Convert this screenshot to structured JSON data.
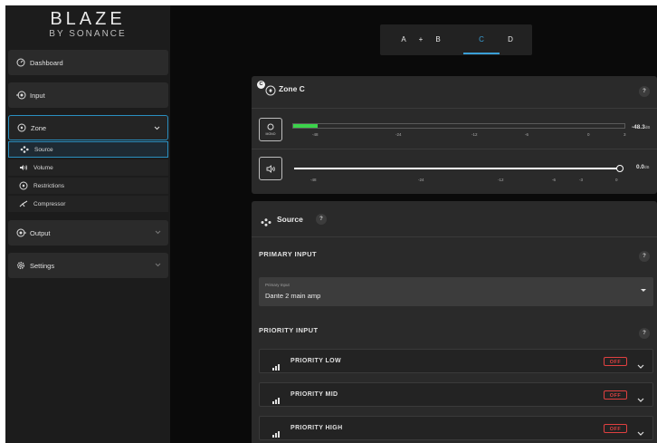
{
  "brand": {
    "name": "BLAZE",
    "sub": "BY SONANCE"
  },
  "sidebar": {
    "items": [
      {
        "label": "Dashboard"
      },
      {
        "label": "Input"
      },
      {
        "label": "Zone"
      },
      {
        "label": "Output"
      },
      {
        "label": "Settings"
      }
    ],
    "zone_sub": [
      {
        "label": "Source"
      },
      {
        "label": "Volume"
      },
      {
        "label": "Restrictions"
      },
      {
        "label": "Compressor"
      }
    ]
  },
  "tabs": [
    "A",
    "+",
    "B",
    "C",
    "D"
  ],
  "active_tab": "C",
  "zone": {
    "badge": "C",
    "title": "Zone C",
    "mono_label": "MONO",
    "meter_ticks": [
      "-48",
      "-24",
      "-12",
      "-6",
      "0",
      "3"
    ],
    "meter_value": "-48.3",
    "meter_unit": "dB",
    "volume_ticks": [
      "-48",
      "-24",
      "-12",
      "-6",
      "-3",
      "0"
    ],
    "volume_value": "0.0",
    "volume_unit": "dB",
    "meter_level": 0.075,
    "volume_level": 1.0
  },
  "source": {
    "title": "Source",
    "primary_heading": "PRIMARY INPUT",
    "primary_field_label": "Primary Input",
    "primary_field_value": "Dante 2 main amp",
    "priority_heading": "PRIORITY INPUT",
    "priorities": [
      {
        "label": "PRIORITY LOW",
        "status": "OFF"
      },
      {
        "label": "PRIORITY MID",
        "status": "OFF"
      },
      {
        "label": "PRIORITY HIGH",
        "status": "OFF"
      }
    ]
  },
  "help_symbol": "?",
  "colors": {
    "accent": "#3a9fd6",
    "meter": "#3bd24a",
    "off": "#e04040"
  }
}
